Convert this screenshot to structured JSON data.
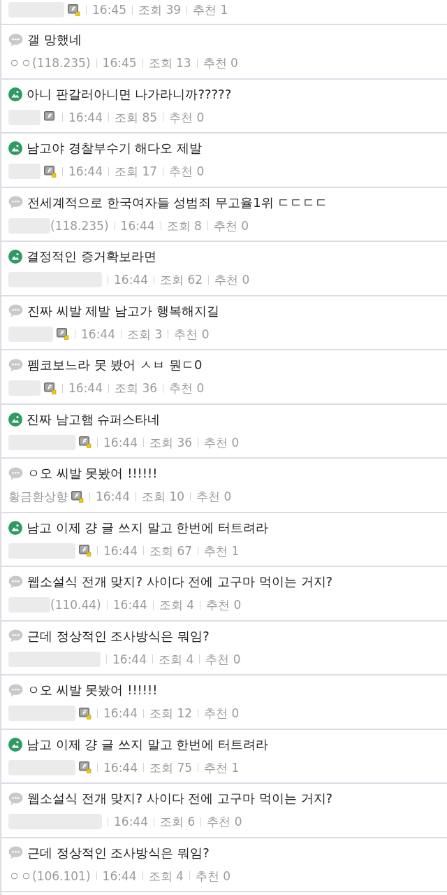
{
  "posts": [
    {
      "author": {
        "blurred": true
      },
      "member_badge": true,
      "badge_dot": true,
      "time": "16:45",
      "views": "조회 39",
      "recommend": "추천 1"
    },
    {
      "kind": "text",
      "title": "갤 망했네",
      "author": {
        "blurred": false,
        "name": "ㅇㅇ(118.235)"
      },
      "member_badge": false,
      "time": "16:45",
      "views": "조회 13",
      "recommend": "추천 0"
    },
    {
      "kind": "image",
      "title": "아니 판갈러아니면 나가라니까?????",
      "author": {
        "blurred": true
      },
      "member_badge": true,
      "badge_dot": false,
      "time": "16:44",
      "views": "조회 85",
      "recommend": "추천 0"
    },
    {
      "kind": "image",
      "title": "남고야 경찰부수기 해다오 제발",
      "author": {
        "blurred": true
      },
      "member_badge": true,
      "badge_dot": true,
      "time": "16:44",
      "views": "조회 17",
      "recommend": "추천 0"
    },
    {
      "kind": "text",
      "title": "전세계적으로 한국여자들 성범죄 무고율1위 ㄷㄷㄷㄷ",
      "author": {
        "blurred": true,
        "ip": "(118.235)"
      },
      "member_badge": false,
      "time": "16:44",
      "views": "조회 8",
      "recommend": "추천 0"
    },
    {
      "kind": "image",
      "title": "결정적인 증거확보라면",
      "author": {
        "blurred": true
      },
      "member_badge": false,
      "time": "16:44",
      "views": "조회 62",
      "recommend": "추천 0"
    },
    {
      "kind": "text",
      "title": "진짜 씨발 제발 남고가 행복해지길",
      "author": {
        "blurred": true
      },
      "member_badge": true,
      "badge_dot": true,
      "time": "16:44",
      "views": "조회 3",
      "recommend": "추천 0"
    },
    {
      "kind": "text",
      "title": "펨코보느라 못 봤어 ㅅㅂ 뭔ㄷ0",
      "author": {
        "blurred": true
      },
      "member_badge": true,
      "badge_dot": true,
      "time": "16:44",
      "views": "조회 36",
      "recommend": "추천 0"
    },
    {
      "kind": "image",
      "title": "진짜 남고햄 슈퍼스타네",
      "author": {
        "blurred": true
      },
      "member_badge": true,
      "badge_dot": true,
      "time": "16:44",
      "views": "조회 36",
      "recommend": "추천 0"
    },
    {
      "kind": "text",
      "title": "ㅇ오 씨발 못봤어 !!!!!!",
      "author": {
        "blurred": false,
        "name": "황금환상향"
      },
      "member_badge": true,
      "badge_dot": true,
      "time": "16:44",
      "views": "조회 10",
      "recommend": "추천 0"
    },
    {
      "kind": "image",
      "title": "남고 이제 걍 글 쓰지 말고 한번에 터트려라",
      "author": {
        "blurred": true
      },
      "member_badge": true,
      "badge_dot": true,
      "time": "16:44",
      "views": "조회 67",
      "recommend": "추천 1"
    },
    {
      "kind": "text",
      "title": "웹소설식 전개 맞지? 사이다 전에 고구마 먹이는 거지?",
      "author": {
        "blurred": true,
        "ip": "(110.44)"
      },
      "member_badge": false,
      "time": "16:44",
      "views": "조회 4",
      "recommend": "추천 0"
    },
    {
      "kind": "text",
      "title": "근데 정상적인 조사방식은 뭐임?",
      "author": {
        "blurred": true
      },
      "member_badge": false,
      "time": "16:44",
      "views": "조회 4",
      "recommend": "추천 0"
    },
    {
      "kind": "text",
      "title": "ㅇ오 씨발 못봤어 !!!!!!",
      "author": {
        "blurred": true
      },
      "member_badge": true,
      "badge_dot": true,
      "time": "16:44",
      "views": "조회 12",
      "recommend": "추천 0"
    },
    {
      "kind": "image",
      "title": "남고 이제 걍 글 쓰지 말고 한번에 터트려라",
      "author": {
        "blurred": true
      },
      "member_badge": true,
      "badge_dot": true,
      "time": "16:44",
      "views": "조회 75",
      "recommend": "추천 1"
    },
    {
      "kind": "text",
      "title": "웹소설식 전개 맞지? 사이다 전에 고구마 먹이는 거지?",
      "author": {
        "blurred": true
      },
      "member_badge": false,
      "time": "16:44",
      "views": "조회 6",
      "recommend": "추천 0"
    },
    {
      "kind": "text",
      "title": "근데 정상적인 조사방식은 뭐임?",
      "author": {
        "blurred": false,
        "name": "ㅇㅇ(106.101)"
      },
      "member_badge": false,
      "time": "16:44",
      "views": "조회 4",
      "recommend": "추천 0"
    }
  ]
}
